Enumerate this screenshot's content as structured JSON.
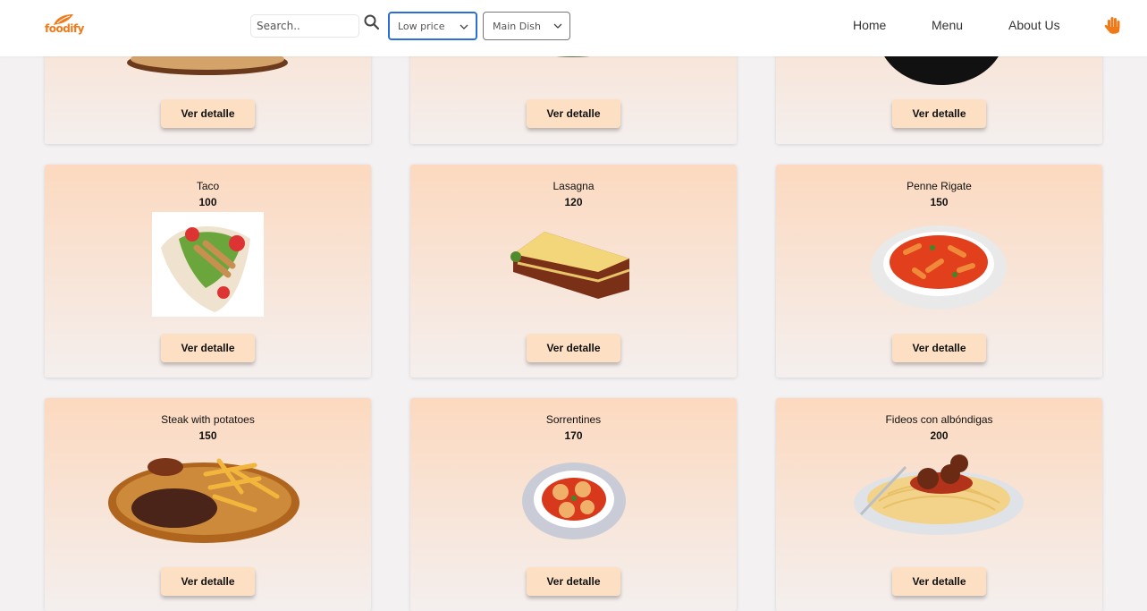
{
  "brand": {
    "logo_text": "foodify"
  },
  "search": {
    "placeholder": "Search.."
  },
  "filters": {
    "price": "Low price",
    "category": "Main Dish"
  },
  "nav": {
    "links": [
      "Home",
      "Menu",
      "About Us"
    ]
  },
  "cards_top": [
    {
      "button": "Ver detalle"
    },
    {
      "button": "Ver detalle"
    },
    {
      "button": "Ver detalle"
    }
  ],
  "cards": [
    {
      "name": "Taco",
      "price": "100",
      "button": "Ver detalle"
    },
    {
      "name": "Lasagna",
      "price": "120",
      "button": "Ver detalle"
    },
    {
      "name": "Penne Rigate",
      "price": "150",
      "button": "Ver detalle"
    },
    {
      "name": "Steak with potatoes",
      "price": "150",
      "button": "Ver detalle"
    },
    {
      "name": "Sorrentines",
      "price": "170",
      "button": "Ver detalle"
    },
    {
      "name": "Fideos con albóndigas",
      "price": "200",
      "button": "Ver detalle"
    }
  ],
  "colors": {
    "accent": "#f07a1a",
    "card_top": "#fcd9bf",
    "button": "#fde0c4",
    "focus": "#2b6fd6"
  }
}
